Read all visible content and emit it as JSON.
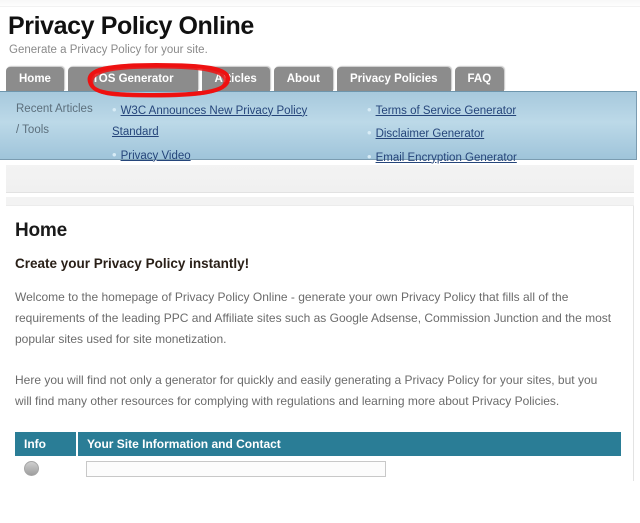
{
  "header": {
    "title": "Privacy Policy Online",
    "tagline": "Generate a Privacy Policy for your site."
  },
  "main_nav": {
    "items": [
      {
        "label": "Home",
        "active": false
      },
      {
        "label": "TOS Generator",
        "active": false,
        "highlighted": true
      },
      {
        "label": "Articles",
        "active": false
      },
      {
        "label": "About",
        "active": false
      },
      {
        "label": "Privacy Policies",
        "active": false
      },
      {
        "label": "FAQ",
        "active": false
      }
    ]
  },
  "sub_nav": {
    "label_line1": "Recent Articles",
    "label_line2": "/ Tools",
    "left_links": [
      {
        "text": "W3C Announces New Privacy Policy",
        "continuation": "Standard"
      },
      {
        "text": "Privacy Video",
        "continuation": ""
      }
    ],
    "right_links": [
      {
        "text": "Terms of Service Generator"
      },
      {
        "text": "Disclaimer Generator"
      },
      {
        "text": "Email Encryption Generator"
      }
    ]
  },
  "content": {
    "page_title": "Home",
    "subtitle": "Create your Privacy Policy instantly!",
    "paragraph_1": "Welcome to the homepage of Privacy Policy Online - generate your own Privacy Policy that fills all of the requirements of the leading PPC and Affiliate sites such as Google Adsense, Commission Junction and the most popular sites used for site monetization.",
    "paragraph_2": "Here you will find not only a generator for quickly and easily generating a Privacy Policy for your sites, but you will find many other resources for complying with regulations and learning more about Privacy Policies."
  },
  "info_table": {
    "headers": {
      "col_info": "Info",
      "col_main": "Your Site Information and Contact"
    },
    "first_row": {
      "icon": "info-circle-icon",
      "input_value": "",
      "input_placeholder": ""
    }
  },
  "annotation": {
    "type": "red-oval-highlight",
    "target": "TOS Generator",
    "color": "#ee1111"
  },
  "colors": {
    "nav_tab_bg": "#8c8c8c",
    "sub_nav_bg": "#b3d2e4",
    "link": "#25457a",
    "table_header_bg": "#2a7d96",
    "annotation_red": "#ee1111"
  }
}
